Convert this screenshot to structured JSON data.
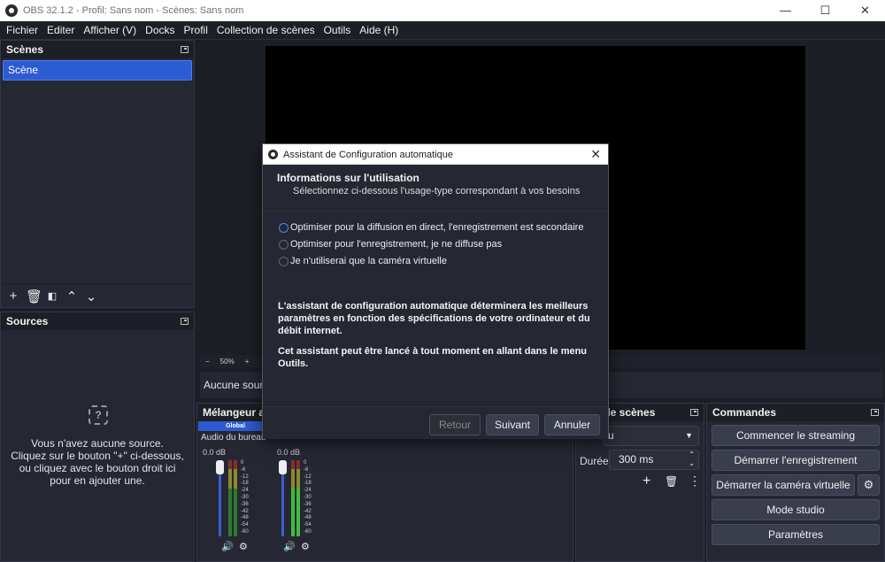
{
  "window": {
    "title": "OBS 32.1.2 - Profil: Sans nom - Scènes: Sans nom",
    "controls": [
      "—",
      "☐",
      "✕"
    ]
  },
  "menu": [
    "Fichier",
    "Editer",
    "Afficher (V)",
    "Docks",
    "Profil",
    "Collection de scènes",
    "Outils",
    "Aide (H)"
  ],
  "scenes": {
    "title": "Scènes",
    "items": [
      "Scène"
    ]
  },
  "sources": {
    "title": "Sources",
    "empty_lines": [
      "Vous n'avez aucune source.",
      "Cliquez sur le bouton \"+\" ci-dessous,",
      "ou cliquez avec le bouton droit ici",
      "pour en ajouter une."
    ]
  },
  "preview": {
    "zoom": "50%",
    "minus": "−",
    "plus": "+"
  },
  "context_bar": {
    "text": "Aucune source"
  },
  "mixer": {
    "title": "Mélangeur au",
    "channel1": {
      "label": "Audio du bureau",
      "db": "0.0 dB",
      "badge": "Global"
    },
    "channel2": {
      "db": "0.0 dB"
    },
    "scale": [
      "0",
      "-6",
      "-12",
      "-18",
      "-24",
      "-30",
      "-36",
      "-42",
      "-48",
      "-54",
      "-60"
    ]
  },
  "transitions": {
    "title": "tion de scènes",
    "select_value": "u",
    "duration_label": "Durée",
    "duration_value": "300 ms"
  },
  "commands": {
    "title": "Commandes",
    "buttons": [
      "Commencer le streaming",
      "Démarrer l'enregistrement",
      "Démarrer la caméra virtuelle",
      "Mode studio",
      "Paramètres"
    ]
  },
  "dialog": {
    "title": "Assistant de Configuration automatique",
    "heading": "Informations sur l'utilisation",
    "subheading": "Sélectionnez ci-dessous l'usage-type correspondant à vos besoins",
    "options": [
      "Optimiser pour la diffusion en direct, l'enregistrement est secondaire",
      "Optimiser pour l'enregistrement, je ne diffuse pas",
      "Je n'utiliserai que la caméra virtuelle"
    ],
    "info1": "L'assistant de configuration automatique déterminera les meilleurs paramètres en fonction des spécifications de votre ordinateur et du débit internet.",
    "info2": "Cet assistant peut être lancé à tout moment en allant dans le menu Outils.",
    "buttons": {
      "back": "Retour",
      "next": "Suivant",
      "cancel": "Annuler"
    }
  },
  "colors": {
    "accent": "#2d5bd1",
    "bg": "#1d1f26",
    "panel": "#252733",
    "meter_green": "#3dbd3d",
    "meter_yellow": "#c9c13c",
    "meter_red": "#c03a3a"
  }
}
